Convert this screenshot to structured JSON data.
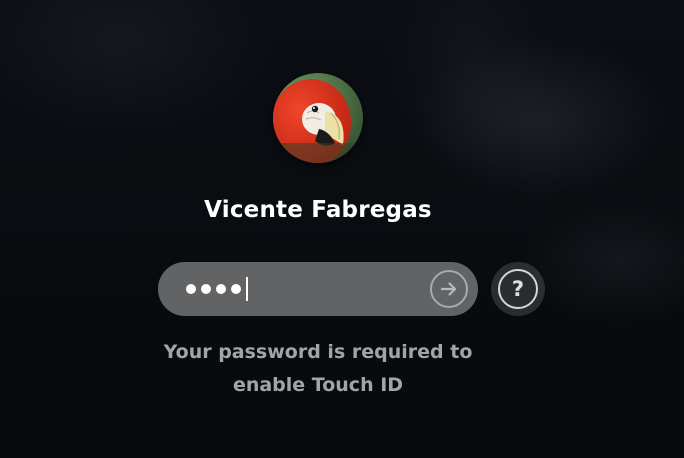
{
  "user": {
    "name": "Vicente Fabregas",
    "avatar_icon": "parrot-avatar"
  },
  "password_field": {
    "masked_characters": 4,
    "mask_glyph": "●"
  },
  "buttons": {
    "submit_icon": "arrow-right-circle-icon",
    "help_label": "?"
  },
  "hint": {
    "line1": "Your password is required to",
    "line2": "enable Touch ID"
  },
  "colors": {
    "background": "#0a0c10",
    "text_primary": "#ffffff",
    "text_secondary": "#cdd0d6"
  }
}
